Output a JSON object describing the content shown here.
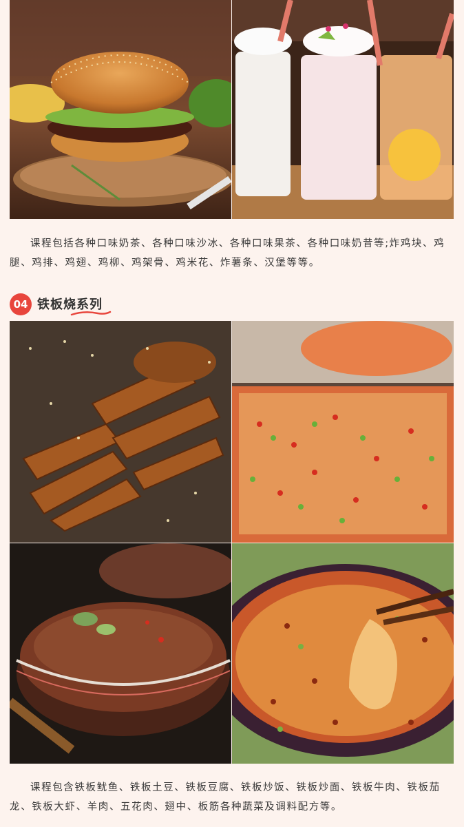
{
  "section_03": {
    "caption": "课程包括各种口味奶茶、各种口味沙冰、各种口味果茶、各种口味奶昔等;炸鸡块、鸡腿、鸡排、鸡翅、鸡柳、鸡架骨、鸡米花、炸薯条、汉堡等等。"
  },
  "section_04": {
    "number": "04",
    "title": "铁板烧系列",
    "caption": "课程包含铁板鱿鱼、铁板土豆、铁板豆腐、铁板炒饭、铁板炒面、铁板牛肉、铁板茄龙、铁板大虾、羊肉、五花肉、翅中、板筋各种蔬菜及调料配方等。"
  },
  "colors": {
    "page_background": "#fdf3ee",
    "accent_red": "#e8453c"
  }
}
